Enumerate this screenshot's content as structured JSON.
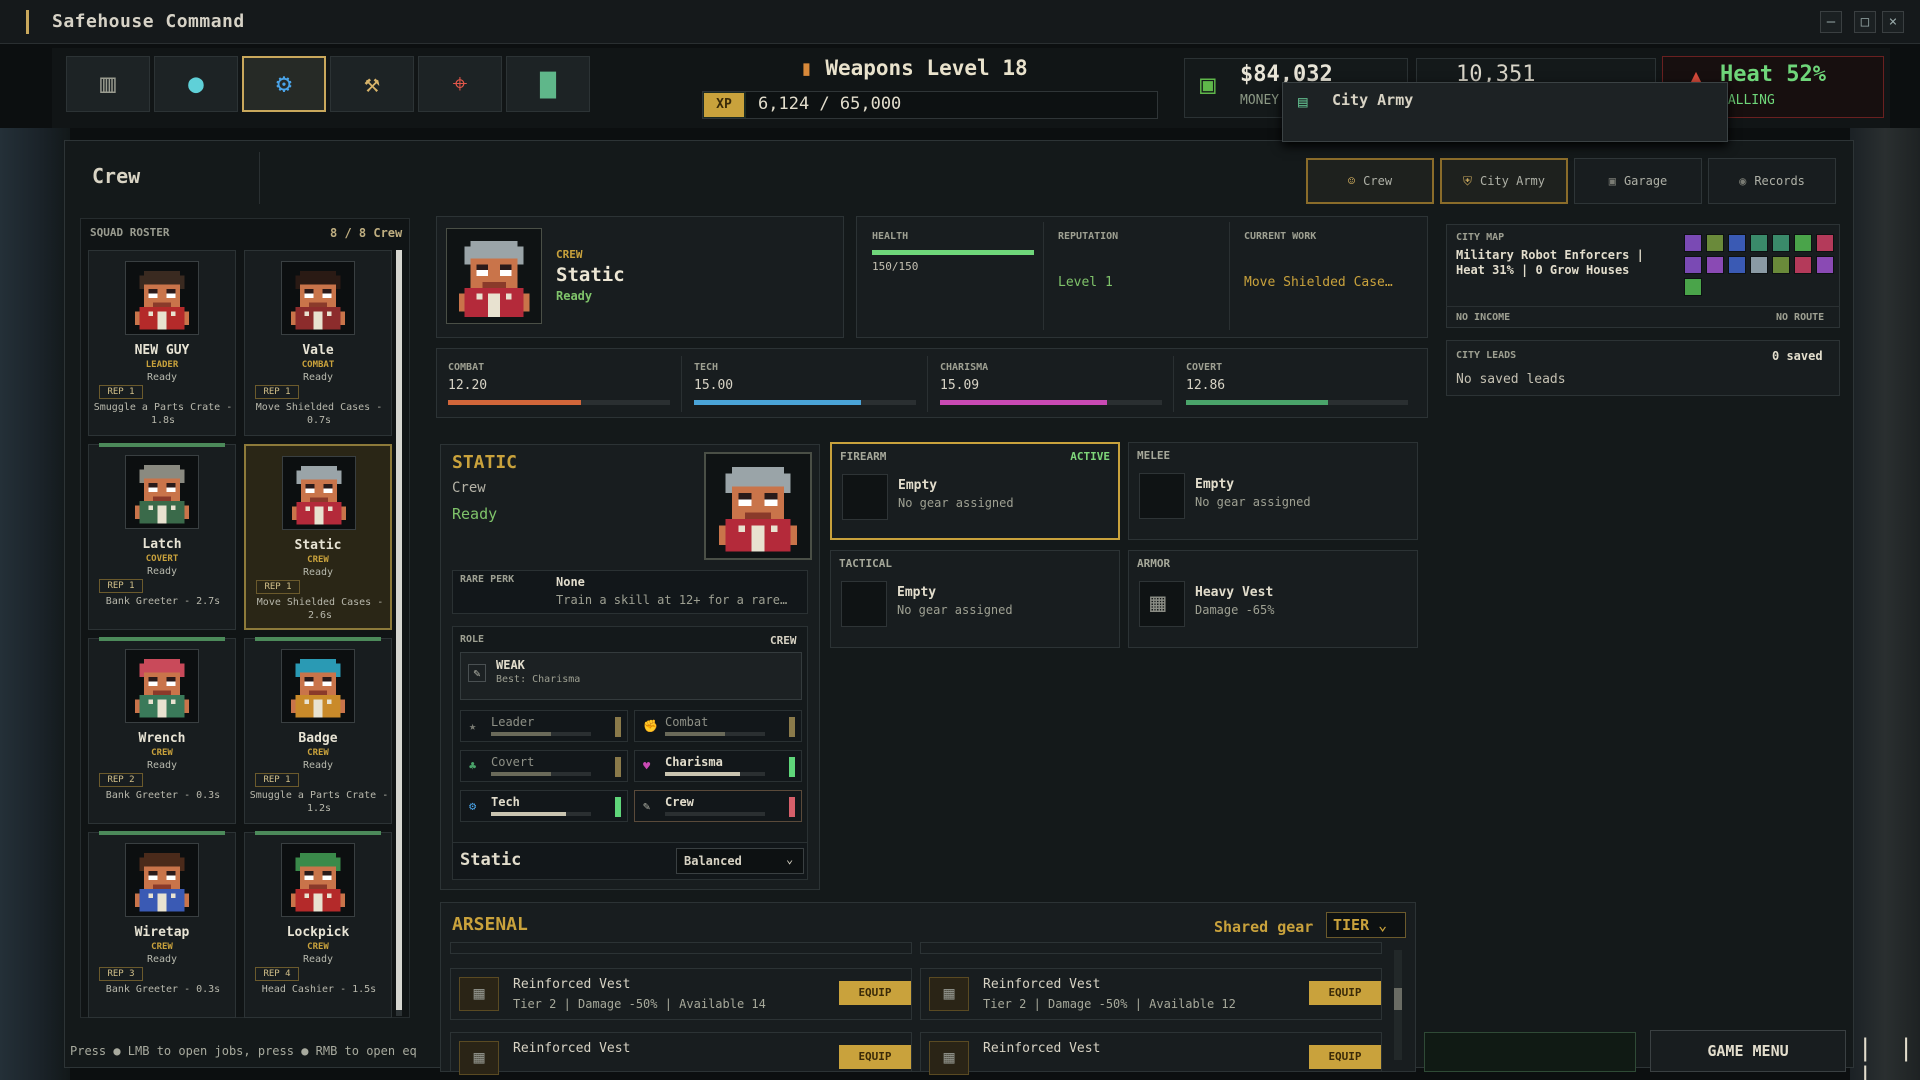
{
  "window": {
    "title": "Safehouse Command"
  },
  "hud": {
    "tools": [
      "ledger-icon",
      "globe-icon",
      "gear-icon",
      "wrench-icon",
      "target-icon",
      "chart-icon"
    ],
    "active_tool": 2,
    "weapons_level": "Weapons Level 18",
    "xp_tag": "XP",
    "xp_text": "6,124 / 65,000",
    "xp_fraction": 0.094,
    "money_value": "$84,032",
    "money_label": "MONEY",
    "mid_value": "10,351",
    "heat_value": "Heat 52%",
    "heat_label": "FALLING"
  },
  "tooltip": {
    "text": "City Army"
  },
  "crew_panel": {
    "title": "Crew"
  },
  "tabs": [
    {
      "label": "Crew",
      "icon": "people-icon",
      "active": false,
      "highlight": true
    },
    {
      "label": "City Army",
      "icon": "shield-icon",
      "active": true,
      "highlight": true
    },
    {
      "label": "Garage",
      "icon": "car-icon",
      "active": false,
      "highlight": false
    },
    {
      "label": "Records",
      "icon": "medal-icon",
      "active": false,
      "highlight": false
    }
  ],
  "roster": {
    "label": "SQUAD ROSTER",
    "count": "8 / 8 Crew",
    "members": [
      {
        "name": "NEW GUY",
        "role": "LEADER",
        "status": "Ready",
        "rep": "REP 1",
        "job": "Smuggle a Parts Crate - 1.8s",
        "skin": "#c9744a",
        "hair": "#3a2a20",
        "shirt": "#b42a2a",
        "selected": false,
        "bar": false
      },
      {
        "name": "Vale",
        "role": "COMBAT",
        "status": "Ready",
        "rep": "REP 1",
        "job": "Move Shielded Cases - 0.7s",
        "skin": "#c9744a",
        "hair": "#2a1a14",
        "shirt": "#8c2c2c",
        "selected": false,
        "bar": false
      },
      {
        "name": "Latch",
        "role": "COVERT",
        "status": "Ready",
        "rep": "REP 1",
        "job": "Bank Greeter - 2.7s",
        "skin": "#c9744a",
        "hair": "#8a8a80",
        "shirt": "#3a6a4a",
        "selected": false,
        "bar": true
      },
      {
        "name": "Static",
        "role": "CREW",
        "status": "Ready",
        "rep": "REP 1",
        "job": "Move Shielded Cases - 2.6s",
        "skin": "#c9744a",
        "hair": "#9aa4a8",
        "shirt": "#b42a3a",
        "selected": true,
        "bar": false
      },
      {
        "name": "Wrench",
        "role": "CREW",
        "status": "Ready",
        "rep": "REP 2",
        "job": "Bank Greeter - 0.3s",
        "skin": "#c9744a",
        "hair": "#c94a5a",
        "shirt": "#3a7a5a",
        "selected": false,
        "bar": true
      },
      {
        "name": "Badge",
        "role": "CREW",
        "status": "Ready",
        "rep": "REP 1",
        "job": "Smuggle a Parts Crate - 1.2s",
        "skin": "#c9744a",
        "hair": "#2a9ab4",
        "shirt": "#c98a2a",
        "selected": false,
        "bar": true
      },
      {
        "name": "Wiretap",
        "role": "CREW",
        "status": "Ready",
        "rep": "REP 3",
        "job": "Bank Greeter - 0.3s",
        "skin": "#c9744a",
        "hair": "#4a2a1a",
        "shirt": "#3a5ab4",
        "selected": false,
        "bar": true
      },
      {
        "name": "Lockpick",
        "role": "CREW",
        "status": "Ready",
        "rep": "REP 4",
        "job": "Head Cashier - 1.5s",
        "skin": "#c9744a",
        "hair": "#3a8a4a",
        "shirt": "#b42a2a",
        "selected": false,
        "bar": true
      }
    ]
  },
  "hint": {
    "text": "Press ● LMB to open jobs, press ● RMB to open eq"
  },
  "profile": {
    "role": "CREW",
    "name": "Static",
    "status": "Ready",
    "health_label": "HEALTH",
    "health_value": "150/150",
    "health_fraction": 1.0,
    "reputation_label": "REPUTATION",
    "reputation_value": "Level 1",
    "work_label": "CURRENT WORK",
    "work_value": "Move Shielded Case…"
  },
  "stats": [
    {
      "label": "COMBAT",
      "value": "12.20",
      "fraction": 0.6,
      "color": "#d2663a"
    },
    {
      "label": "TECH",
      "value": "15.00",
      "fraction": 0.75,
      "color": "#4aa4d8"
    },
    {
      "label": "CHARISMA",
      "value": "15.09",
      "fraction": 0.75,
      "color": "#c94ab4"
    },
    {
      "label": "COVERT",
      "value": "12.86",
      "fraction": 0.64,
      "color": "#4aa46a"
    }
  ],
  "detail": {
    "name": "STATIC",
    "role": "Crew",
    "status": "Ready",
    "perk_label": "RARE PERK",
    "perk_value": "None",
    "perk_hint": "Train a skill at 12+ for a rare…",
    "role_label": "ROLE",
    "role_value": "CREW",
    "role_card_title": "WEAK",
    "role_card_sub": "Best: Charisma",
    "skills": [
      {
        "name": "Leader",
        "icon": "star-icon",
        "fraction": 0.6,
        "color": "#6a6a5a",
        "tick": "#8a7a4a",
        "active": false
      },
      {
        "name": "Combat",
        "icon": "fist-icon",
        "fraction": 0.6,
        "color": "#6a6a5a",
        "tick": "#8a7a4a",
        "active": false
      },
      {
        "name": "Covert",
        "icon": "leaf-icon",
        "fraction": 0.6,
        "color": "#6a6a5a",
        "tick": "#8a7a4a",
        "active": false
      },
      {
        "name": "Charisma",
        "icon": "heart-icon",
        "fraction": 0.75,
        "color": "#c9c4b0",
        "tick": "#5fd67a",
        "active": true
      },
      {
        "name": "Tech",
        "icon": "gear-icon",
        "fraction": 0.75,
        "color": "#c9c4b0",
        "tick": "#5fd67a",
        "active": true
      },
      {
        "name": "Crew",
        "icon": "pencil-icon",
        "fraction": 0.0,
        "color": "#6a6a5a",
        "tick": "#d65f6a",
        "active": true
      }
    ],
    "loadout_name": "Static",
    "loadout_mode": "Balanced"
  },
  "gear": [
    {
      "slot": "FIREARM",
      "badge": "ACTIVE",
      "title": "Empty",
      "sub": "No gear assigned",
      "active": true
    },
    {
      "slot": "MELEE",
      "badge": "",
      "title": "Empty",
      "sub": "No gear assigned",
      "active": false
    },
    {
      "slot": "TACTICAL",
      "badge": "",
      "title": "Empty",
      "sub": "No gear assigned",
      "active": false
    },
    {
      "slot": "ARMOR",
      "badge": "",
      "title": "Heavy Vest",
      "sub": "Damage -65%",
      "active": false
    }
  ],
  "arsenal": {
    "title": "ARSENAL",
    "shared_label": "Shared gear",
    "tier_label": "TIER",
    "rows": [
      {
        "name": "Reinforced Vest",
        "sub": "Tier 2 | Damage -50% | Available 14",
        "button": "EQUIP"
      },
      {
        "name": "Reinforced Vest",
        "sub": "Tier 2 | Damage -50% | Available 12",
        "button": "EQUIP"
      },
      {
        "name": "Reinforced Vest",
        "sub": "",
        "button": "EQUIP"
      },
      {
        "name": "Reinforced Vest",
        "sub": "",
        "button": "EQUIP"
      }
    ]
  },
  "city_map": {
    "label": "CITY MAP",
    "text": "Military Robot Enforcers | Heat 31% | 0 Grow Houses",
    "income": "NO INCOME",
    "route": "NO ROUTE",
    "tiles": [
      "#7a4ab4",
      "#6a8a3a",
      "#3a5ab4",
      "#3a8a6a",
      "#3a8a6a",
      "#4aa44a",
      "#b43a5a",
      "#7a4ab4",
      "#8a4ab4",
      "#3a5ab4",
      "#8a9aa4",
      "#6a8a3a",
      "#b43a5a",
      "#8a4ab4",
      "#4aa44a"
    ]
  },
  "city_leads": {
    "label": "CITY LEADS",
    "count": "0 saved",
    "text": "No saved leads"
  },
  "bottom": {
    "game_menu": "GAME MENU",
    "pause": "| | |"
  }
}
